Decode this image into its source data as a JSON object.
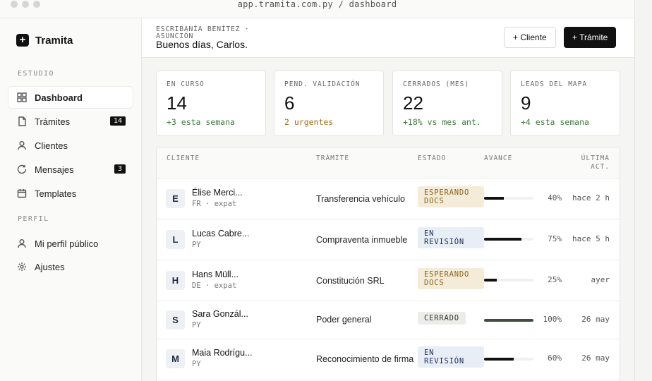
{
  "window": {
    "url": "app.tramita.com.py / dashboard"
  },
  "brand": {
    "name": "Tramita",
    "mark": "+"
  },
  "sidebar": {
    "section_estudio": "ESTUDIO",
    "section_perfil": "PERFIL",
    "items": [
      {
        "label": "Dashboard",
        "icon": "grid-icon",
        "active": true
      },
      {
        "label": "Trámites",
        "icon": "document-icon",
        "badge": "14"
      },
      {
        "label": "Clientes",
        "icon": "user-icon"
      },
      {
        "label": "Mensajes",
        "icon": "chat-icon",
        "badge": "3"
      },
      {
        "label": "Templates",
        "icon": "calendar-icon"
      },
      {
        "label": "Mi perfil público",
        "icon": "user-icon"
      },
      {
        "label": "Ajustes",
        "icon": "gear-icon"
      }
    ]
  },
  "header": {
    "org": "ESCRIBANÍA BENÍTEZ · ASUNCIÓN",
    "greeting": "Buenos días, Carlos.",
    "btn_cliente": "+ Cliente",
    "btn_tramite": "+ Trámite"
  },
  "stats": [
    {
      "label": "EN CURSO",
      "value": "14",
      "sub": "+3 esta semana",
      "tone": "green"
    },
    {
      "label": "PEND. VALIDACIÓN",
      "value": "6",
      "sub": "2 urgentes",
      "tone": "amber"
    },
    {
      "label": "CERRADOS (MES)",
      "value": "22",
      "sub": "+18% vs mes ant.",
      "tone": "green"
    },
    {
      "label": "LEADS DEL MAPA",
      "value": "9",
      "sub": "+4 esta semana",
      "tone": "green"
    }
  ],
  "table": {
    "headers": {
      "cliente": "CLIENTE",
      "tramite": "TRÁMITE",
      "estado": "ESTADO",
      "avance": "AVANCE",
      "ultima": "ÚLTIMA ACT."
    },
    "rows": [
      {
        "initial": "E",
        "name": "Élise Merci...",
        "country": "FR · expat",
        "tramite": "Transferencia vehículo",
        "status": "ESPERANDO DOCS",
        "status_kind": "wait",
        "progress": 40,
        "pct": "40%",
        "updated": "hace 2 h"
      },
      {
        "initial": "L",
        "name": "Lucas Cabre...",
        "country": "PY",
        "tramite": "Compraventa inmueble",
        "status": "EN REVISIÓN",
        "status_kind": "rev",
        "progress": 75,
        "pct": "75%",
        "updated": "hace 5 h"
      },
      {
        "initial": "H",
        "name": "Hans Müll...",
        "country": "DE · expat",
        "tramite": "Constitución SRL",
        "status": "ESPERANDO DOCS",
        "status_kind": "wait",
        "progress": 25,
        "pct": "25%",
        "updated": "ayer"
      },
      {
        "initial": "S",
        "name": "Sara Gonzál...",
        "country": "PY",
        "tramite": "Poder general",
        "status": "CERRADO",
        "status_kind": "done",
        "progress": 100,
        "pct": "100%",
        "updated": "26 may"
      },
      {
        "initial": "M",
        "name": "Maia Rodrígu...",
        "country": "PY",
        "tramite": "Reconocimiento de firma",
        "status": "EN REVISIÓN",
        "status_kind": "rev",
        "progress": 60,
        "pct": "60%",
        "updated": "26 may"
      }
    ]
  }
}
